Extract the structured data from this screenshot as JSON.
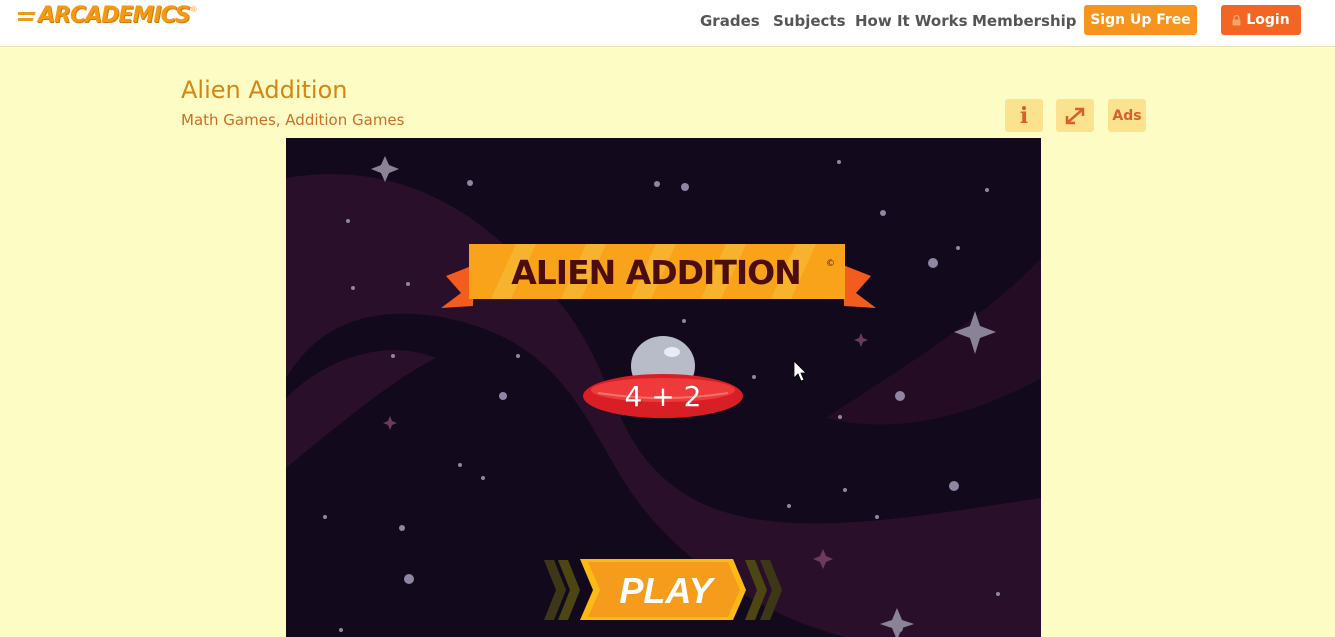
{
  "header": {
    "logo_text": "ARCADEMICS",
    "logo_mark": "®",
    "nav": [
      "Grades",
      "Subjects",
      "How It Works",
      "Membership"
    ],
    "signup_label": "Sign Up Free",
    "login_label": "Login"
  },
  "game": {
    "title": "Alien Addition",
    "categories": "Math Games, Addition Games",
    "tools": {
      "info_label": "i",
      "ads_label": "Ads"
    },
    "banner_title": "ALIEN ADDITION",
    "banner_mark": "©",
    "ufo_problem": "4 + 2",
    "play_label": "PLAY"
  },
  "colors": {
    "page_bg": "#fdfcc5",
    "brand_orange": "#f7941d",
    "login_orange": "#f26522",
    "game_bg": "#120a1c"
  }
}
